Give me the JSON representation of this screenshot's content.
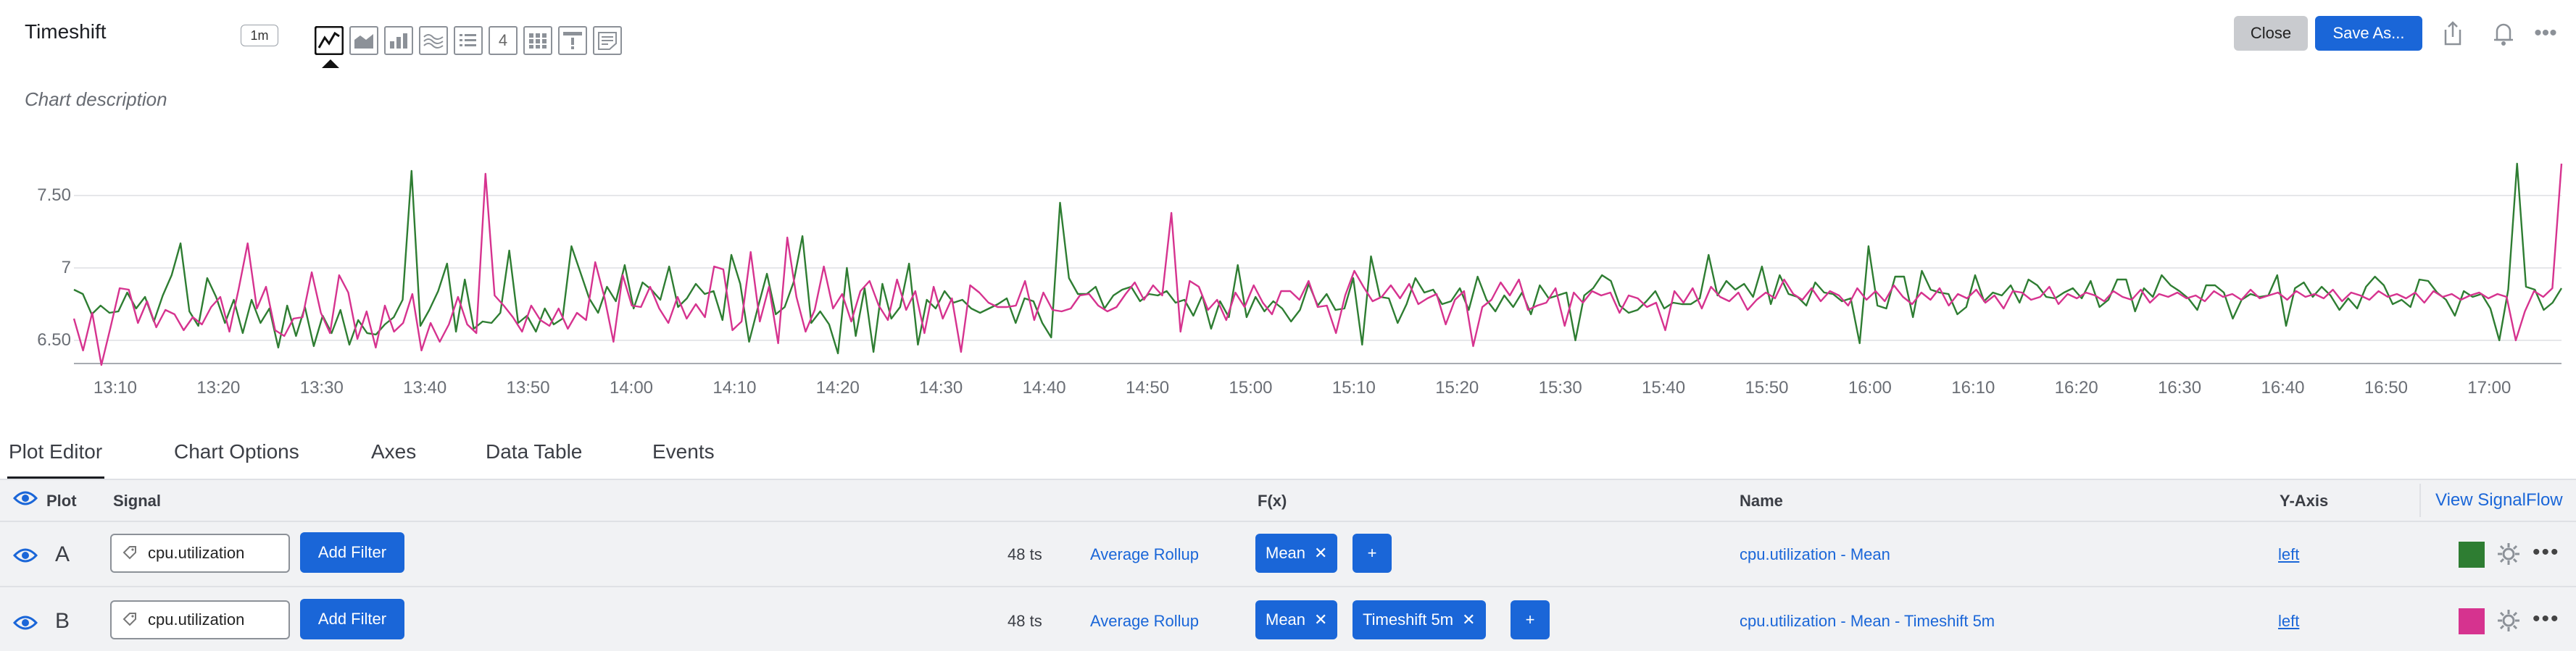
{
  "header": {
    "title": "Timeshift",
    "resolution": "1m",
    "description": "Chart description",
    "chart_types": [
      "line-chart-icon",
      "area-chart-icon",
      "column-chart-icon",
      "histogram-icon",
      "list-icon",
      "single-value-icon",
      "heatmap-icon",
      "event-feed-icon",
      "text-note-icon"
    ],
    "single_value_glyph": "4",
    "close_label": "Close",
    "save_label": "Save As...",
    "icons": [
      "share-icon",
      "bell-icon",
      "more-icon"
    ]
  },
  "tabs": [
    "Plot Editor",
    "Chart Options",
    "Axes",
    "Data Table",
    "Events"
  ],
  "columns": {
    "plot": "Plot",
    "signal": "Signal",
    "fx": "F(x)",
    "name": "Name",
    "yaxis": "Y-Axis",
    "view_signalflow": "View SignalFlow"
  },
  "rows": [
    {
      "letter": "A",
      "signal": "cpu.utilization",
      "add_filter": "Add Filter",
      "ts_count": "48 ts",
      "rollup": "Average Rollup",
      "functions": [
        "Mean"
      ],
      "plus": "+",
      "name": "cpu.utilization - Mean",
      "axis": "left",
      "color": "#2e7d32"
    },
    {
      "letter": "B",
      "signal": "cpu.utilization",
      "add_filter": "Add Filter",
      "ts_count": "48 ts",
      "rollup": "Average Rollup",
      "functions": [
        "Mean",
        "Timeshift 5m"
      ],
      "plus": "+",
      "name": "cpu.utilization - Mean - Timeshift 5m",
      "axis": "left",
      "color": "#d6338f"
    }
  ],
  "chart_data": {
    "type": "line",
    "y_ticks": [
      "6.50",
      "7",
      "7.50"
    ],
    "ylim": [
      6.35,
      7.85
    ],
    "x_ticks": [
      "13:10",
      "13:20",
      "13:30",
      "13:40",
      "13:50",
      "14:00",
      "14:10",
      "14:20",
      "14:30",
      "14:40",
      "14:50",
      "15:00",
      "15:10",
      "15:20",
      "15:30",
      "15:40",
      "15:50",
      "16:00",
      "16:10",
      "16:20",
      "16:30",
      "16:40",
      "16:50",
      "17:00"
    ],
    "x_start": "13:06",
    "x_end": "17:07",
    "grid": true,
    "series": [
      {
        "color": "#2e7d32",
        "values": [
          6.85,
          6.82,
          6.68,
          6.74,
          6.69,
          6.7,
          6.83,
          6.72,
          6.8,
          6.63,
          6.81,
          6.95,
          7.17,
          6.7,
          6.6,
          6.93,
          6.8,
          6.62,
          6.78,
          6.55,
          6.78,
          6.62,
          6.72,
          6.45,
          6.74,
          6.53,
          6.73,
          6.46,
          6.67,
          6.55,
          6.71,
          6.47,
          6.64,
          6.55,
          6.54,
          6.61,
          6.66,
          6.78,
          7.67,
          6.6,
          6.71,
          6.84,
          7.03,
          6.56,
          6.92,
          6.58,
          6.63,
          6.62,
          6.69,
          7.12,
          6.62,
          6.67,
          6.56,
          6.72,
          6.61,
          6.65,
          7.15,
          6.97,
          6.79,
          6.69,
          6.87,
          6.77,
          7.02,
          6.72,
          6.9,
          6.85,
          6.78,
          7.01,
          6.73,
          6.79,
          6.89,
          6.82,
          6.84,
          6.64,
          7.09,
          6.89,
          6.49,
          6.73,
          6.96,
          6.68,
          6.73,
          6.9,
          7.22,
          6.62,
          6.7,
          6.61,
          6.41,
          7.0,
          6.53,
          6.86,
          6.42,
          6.89,
          6.65,
          6.73,
          7.03,
          6.47,
          6.78,
          6.72,
          6.84,
          6.76,
          6.78,
          6.72,
          6.69,
          6.72,
          6.75,
          6.79,
          6.62,
          6.79,
          6.77,
          6.62,
          6.52,
          7.45,
          6.93,
          6.82,
          6.82,
          6.87,
          6.72,
          6.81,
          6.85,
          6.87,
          6.77,
          6.82,
          6.81,
          6.84,
          6.76,
          6.78,
          6.67,
          6.81,
          6.58,
          6.77,
          6.66,
          7.02,
          6.66,
          6.8,
          6.7,
          6.77,
          6.72,
          6.63,
          6.71,
          6.89,
          6.74,
          6.82,
          6.71,
          6.72,
          6.93,
          6.47,
          7.08,
          6.8,
          6.79,
          6.62,
          6.75,
          6.93,
          6.83,
          6.85,
          6.75,
          6.77,
          6.86,
          6.71,
          6.94,
          6.78,
          6.7,
          6.81,
          6.73,
          6.83,
          6.68,
          6.88,
          6.79,
          6.81,
          6.83,
          6.5,
          6.81,
          6.86,
          6.95,
          6.91,
          6.74,
          6.69,
          6.71,
          6.77,
          6.84,
          6.72,
          6.76,
          6.75,
          6.75,
          6.79,
          7.09,
          6.81,
          6.91,
          6.85,
          6.89,
          6.8,
          7.01,
          6.75,
          6.95,
          6.82,
          6.8,
          6.74,
          6.9,
          6.83,
          6.82,
          6.77,
          6.79,
          6.48,
          7.15,
          6.74,
          6.72,
          6.94,
          6.94,
          6.66,
          6.98,
          6.85,
          6.83,
          6.82,
          6.68,
          6.73,
          6.95,
          6.77,
          6.83,
          6.81,
          6.88,
          6.76,
          6.92,
          6.88,
          6.8,
          6.79,
          6.83,
          6.86,
          6.79,
          6.91,
          6.73,
          6.78,
          6.92,
          6.92,
          6.7,
          6.86,
          6.8,
          6.95,
          6.88,
          6.84,
          6.79,
          6.71,
          6.88,
          6.88,
          6.83,
          6.65,
          6.78,
          6.82,
          6.8,
          6.81,
          6.95,
          6.6,
          6.86,
          6.9,
          6.8,
          6.87,
          6.81,
          6.71,
          6.79,
          6.72,
          6.87,
          6.94,
          6.88,
          6.75,
          6.78,
          6.73,
          6.92,
          6.91,
          6.83,
          6.78,
          6.67,
          6.84,
          6.8,
          6.82,
          6.72,
          6.5,
          6.85,
          7.72,
          6.87,
          6.85,
          6.71,
          6.76,
          6.86
        ]
      },
      {
        "color": "#d6338f",
        "values": [
          6.65,
          6.43,
          6.69,
          6.33,
          6.59,
          6.86,
          6.85,
          6.62,
          6.77,
          6.59,
          6.71,
          6.68,
          6.57,
          6.66,
          6.61,
          6.73,
          6.8,
          6.56,
          6.85,
          7.17,
          6.72,
          6.87,
          6.57,
          6.53,
          6.65,
          6.66,
          6.97,
          6.69,
          6.55,
          6.95,
          6.83,
          6.51,
          6.7,
          6.45,
          6.74,
          6.56,
          6.62,
          6.82,
          6.43,
          6.62,
          6.49,
          6.61,
          6.8,
          6.61,
          6.55,
          7.65,
          6.81,
          6.74,
          6.66,
          6.56,
          6.74,
          6.64,
          6.6,
          6.72,
          6.58,
          6.69,
          6.64,
          7.04,
          6.8,
          6.49,
          6.95,
          6.74,
          6.73,
          6.87,
          6.72,
          6.62,
          6.8,
          6.65,
          6.75,
          6.66,
          7.01,
          6.99,
          6.57,
          6.63,
          7.11,
          6.63,
          6.87,
          6.48,
          7.21,
          6.8,
          6.56,
          6.71,
          7.01,
          6.72,
          6.82,
          6.63,
          6.84,
          6.91,
          6.74,
          6.64,
          6.92,
          6.71,
          6.84,
          6.55,
          6.87,
          6.65,
          6.79,
          6.42,
          6.88,
          6.83,
          6.76,
          6.73,
          6.73,
          6.74,
          6.91,
          6.64,
          6.83,
          6.71,
          6.7,
          6.72,
          6.81,
          6.82,
          6.74,
          6.7,
          6.73,
          6.82,
          6.9,
          6.78,
          6.88,
          6.81,
          7.38,
          6.56,
          6.91,
          6.87,
          6.71,
          6.78,
          6.64,
          6.83,
          6.73,
          6.88,
          6.76,
          6.68,
          6.84,
          6.84,
          6.78,
          6.91,
          6.73,
          6.74,
          6.55,
          6.81,
          6.98,
          6.87,
          6.77,
          6.8,
          6.88,
          6.79,
          6.89,
          6.75,
          6.79,
          6.82,
          6.61,
          6.78,
          6.84,
          6.46,
          6.73,
          6.78,
          6.9,
          6.81,
          6.92,
          6.71,
          6.74,
          6.76,
          6.86,
          6.6,
          6.83,
          6.76,
          6.84,
          6.81,
          6.83,
          6.69,
          6.81,
          6.79,
          6.73,
          6.76,
          6.57,
          6.84,
          6.76,
          6.86,
          6.72,
          6.87,
          6.8,
          6.77,
          6.83,
          6.71,
          6.78,
          6.83,
          6.79,
          6.92,
          6.82,
          6.78,
          6.86,
          6.77,
          6.84,
          6.81,
          6.74,
          6.86,
          6.78,
          6.84,
          6.77,
          6.88,
          6.8,
          6.75,
          6.83,
          6.78,
          6.86,
          6.74,
          6.82,
          6.79,
          6.85,
          6.76,
          6.81,
          6.72,
          6.84,
          6.83,
          6.78,
          6.8,
          6.87,
          6.75,
          6.82,
          6.79,
          6.83,
          6.81,
          6.77,
          6.84,
          6.8,
          6.78,
          6.85,
          6.76,
          6.82,
          6.8,
          6.83,
          6.79,
          6.81,
          6.77,
          6.84,
          6.8,
          6.82,
          6.78,
          6.85,
          6.79,
          6.81,
          6.83,
          6.78,
          6.84,
          6.8,
          6.82,
          6.79,
          6.85,
          6.77,
          6.83,
          6.81,
          6.78,
          6.84,
          6.8,
          6.82,
          6.79,
          6.83,
          6.76,
          6.84,
          6.8,
          6.82,
          6.78,
          6.81,
          6.83,
          6.79,
          6.82,
          6.8,
          6.5,
          6.7,
          6.84,
          6.8,
          6.86,
          7.72
        ]
      }
    ]
  }
}
